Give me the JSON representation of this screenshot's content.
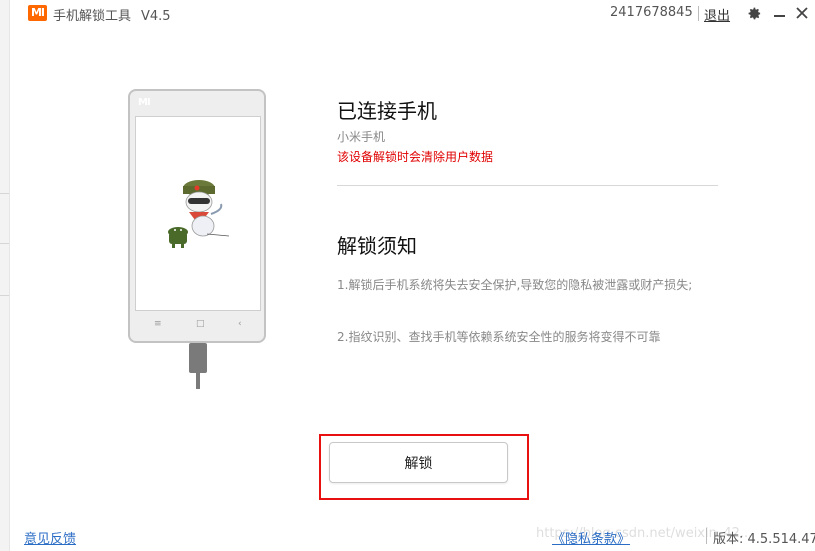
{
  "titlebar": {
    "logo_text": "MI",
    "app_title": "手机解锁工具",
    "version": "V4.5",
    "account_id": "2417678845",
    "logout_label": "退出",
    "settings_icon": "gear-icon",
    "minimize_icon": "minimize-icon",
    "close_icon": "close-icon"
  },
  "phone": {
    "brand_text": "MI",
    "nav_menu": "≡",
    "nav_home": "□",
    "nav_back": "‹"
  },
  "status": {
    "heading": "已连接手机",
    "model": "小米手机",
    "warning": "该设备解锁时会清除用户数据"
  },
  "notice": {
    "heading": "解锁须知",
    "items": [
      "1.解锁后手机系统将失去安全保护,导致您的隐私被泄露或财产损失;",
      "2.指纹识别、查找手机等依赖系统安全性的服务将变得不可靠"
    ]
  },
  "actions": {
    "unlock_label": "解锁"
  },
  "footer": {
    "feedback_label": "意见反馈",
    "privacy_label": "《隐私条款》",
    "version_text": "版本: 4.5.514.47",
    "watermark": "https://blog.csdn.net/weixin_42..."
  },
  "colors": {
    "brand": "#ff6700",
    "warning": "#e00000",
    "link": "#2b6cc4",
    "highlight_box": "#e81010"
  }
}
